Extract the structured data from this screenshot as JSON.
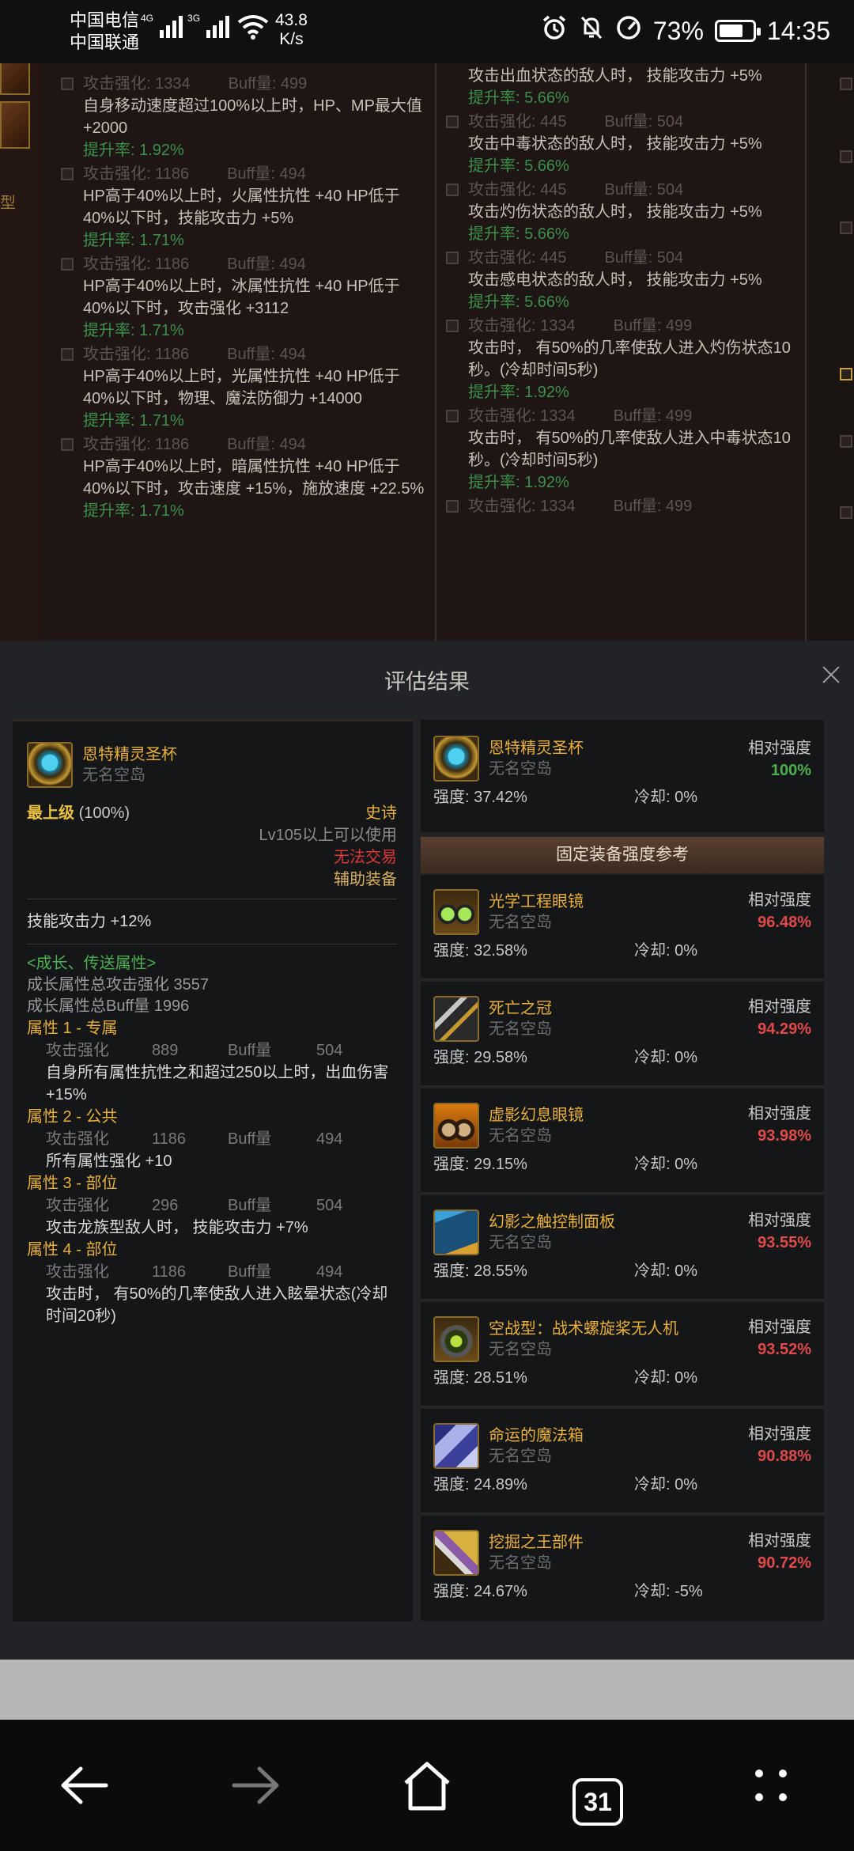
{
  "status_bar": {
    "carrier1": "中国电信",
    "carrier2": "中国联通",
    "net1": "4G",
    "net2": "3G",
    "speed_value": "43.8",
    "speed_unit": "K/s",
    "battery": "73%",
    "time": "14:35"
  },
  "background": {
    "left_label": "型",
    "col1": [
      {
        "atk": "攻击强化: 1334",
        "buff": "Buff量: 499",
        "desc": "自身移动速度超过100%以上时，HP、MP最大值 +2000",
        "rate": "提升率: 1.92%"
      },
      {
        "atk": "攻击强化: 1186",
        "buff": "Buff量: 494",
        "desc": "HP高于40%以上时，火属性抗性 +40 HP低于40%以下时，技能攻击力 +5%",
        "rate": "提升率: 1.71%"
      },
      {
        "atk": "攻击强化: 1186",
        "buff": "Buff量: 494",
        "desc": "HP高于40%以上时，冰属性抗性 +40 HP低于40%以下时，攻击强化 +3112",
        "rate": "提升率: 1.71%"
      },
      {
        "atk": "攻击强化: 1186",
        "buff": "Buff量: 494",
        "desc": "HP高于40%以上时，光属性抗性 +40 HP低于40%以下时，物理、魔法防御力 +14000",
        "rate": "提升率: 1.71%"
      },
      {
        "atk": "攻击强化: 1186",
        "buff": "Buff量: 494",
        "desc": "HP高于40%以上时，暗属性抗性 +40 HP低于40%以下时，攻击速度 +15%，施放速度 +22.5%",
        "rate": "提升率: 1.71%"
      }
    ],
    "col2_top_desc": "攻击出血状态的敌人时， 技能攻击力 +5%",
    "col2_top_rate": "提升率: 5.66%",
    "col2": [
      {
        "atk": "攻击强化: 445",
        "buff": "Buff量: 504",
        "desc": "攻击中毒状态的敌人时， 技能攻击力 +5%",
        "rate": "提升率: 5.66%"
      },
      {
        "atk": "攻击强化: 445",
        "buff": "Buff量: 504",
        "desc": "攻击灼伤状态的敌人时， 技能攻击力 +5%",
        "rate": "提升率: 5.66%"
      },
      {
        "atk": "攻击强化: 445",
        "buff": "Buff量: 504",
        "desc": "攻击感电状态的敌人时， 技能攻击力 +5%",
        "rate": "提升率: 5.66%"
      },
      {
        "atk": "攻击强化: 1334",
        "buff": "Buff量: 499",
        "desc": "攻击时， 有50%的几率使敌人进入灼伤状态10秒。(冷却时间5秒)",
        "rate": "提升率: 1.92%"
      },
      {
        "atk": "攻击强化: 1334",
        "buff": "Buff量: 499",
        "desc": "攻击时， 有50%的几率使敌人进入中毒状态10秒。(冷却时间5秒)",
        "rate": "提升率: 1.92%"
      }
    ],
    "col2_bottom_atk": "攻击强化: 1334",
    "col2_bottom_buff": "Buff量: 499"
  },
  "modal": {
    "title": "评估结果",
    "item": {
      "name": "恩特精灵圣杯",
      "owner": "无名空岛",
      "grade_label": "最上级",
      "grade_pct": "(100%)",
      "rarity": "史诗",
      "level_req": "Lv105以上可以使用",
      "trade": "无法交易",
      "type": "辅助装备",
      "skill": "技能攻击力   +12%",
      "growth_header": "<成长、传送属性>",
      "growth_atk": "成长属性总攻击强化 3557",
      "growth_buff": "成长属性总Buff量 1996",
      "attrs": [
        {
          "title": "属性 1 - 专属",
          "atk_label": "攻击强化",
          "atk": "889",
          "buff_label": "Buff量",
          "buff": "504",
          "desc": "自身所有属性抗性之和超过250以上时，出血伤害 +15%"
        },
        {
          "title": "属性 2 - 公共",
          "atk_label": "攻击强化",
          "atk": "1186",
          "buff_label": "Buff量",
          "buff": "494",
          "desc": "所有属性强化 +10"
        },
        {
          "title": "属性 3 - 部位",
          "atk_label": "攻击强化",
          "atk": "296",
          "buff_label": "Buff量",
          "buff": "504",
          "desc": "攻击龙族型敌人时， 技能攻击力 +7%"
        },
        {
          "title": "属性 4 - 部位",
          "atk_label": "攻击强化",
          "atk": "1186",
          "buff_label": "Buff量",
          "buff": "494",
          "desc": "攻击时， 有50%的几率使敌人进入眩晕状态(冷却时间20秒)"
        }
      ]
    },
    "current": {
      "name": "恩特精灵圣杯",
      "owner": "无名空岛",
      "rel_label": "相对强度",
      "rel_value": "100%",
      "strength": "强度: 37.42%",
      "cooldown": "冷却: 0%"
    },
    "reference_header": "固定装备强度参考",
    "reference": [
      {
        "name": "光学工程眼镜",
        "owner": "无名空岛",
        "rel_label": "相对强度",
        "rel_value": "96.48%",
        "strength": "强度: 32.58%",
        "cooldown": "冷却: 0%",
        "icon": "glasses-icon"
      },
      {
        "name": "死亡之冠",
        "owner": "无名空岛",
        "rel_label": "相对强度",
        "rel_value": "94.29%",
        "strength": "强度: 29.58%",
        "cooldown": "冷却: 0%",
        "icon": "crown-icon"
      },
      {
        "name": "虚影幻息眼镜",
        "owner": "无名空岛",
        "rel_label": "相对强度",
        "rel_value": "93.98%",
        "strength": "强度: 29.15%",
        "cooldown": "冷却: 0%",
        "icon": "phantom-goggles-icon"
      },
      {
        "name": "幻影之触控制面板",
        "owner": "无名空岛",
        "rel_label": "相对强度",
        "rel_value": "93.55%",
        "strength": "强度: 28.55%",
        "cooldown": "冷却: 0%",
        "icon": "control-panel-icon"
      },
      {
        "name": "空战型：战术螺旋桨无人机",
        "owner": "无名空岛",
        "rel_label": "相对强度",
        "rel_value": "93.52%",
        "strength": "强度: 28.51%",
        "cooldown": "冷却: 0%",
        "icon": "drone-icon"
      },
      {
        "name": "命运的魔法箱",
        "owner": "无名空岛",
        "rel_label": "相对强度",
        "rel_value": "90.88%",
        "strength": "强度: 24.89%",
        "cooldown": "冷却: 0%",
        "icon": "magic-box-icon"
      },
      {
        "name": "挖掘之王部件",
        "owner": "无名空岛",
        "rel_label": "相对强度",
        "rel_value": "90.72%",
        "strength": "强度: 24.67%",
        "cooldown": "冷却: -5%",
        "icon": "drill-icon"
      }
    ]
  },
  "navbar": {
    "tabs_count": "31"
  },
  "colors": {
    "gold": "#e8b03a",
    "green": "#4caf50",
    "red": "#e04a4a"
  }
}
